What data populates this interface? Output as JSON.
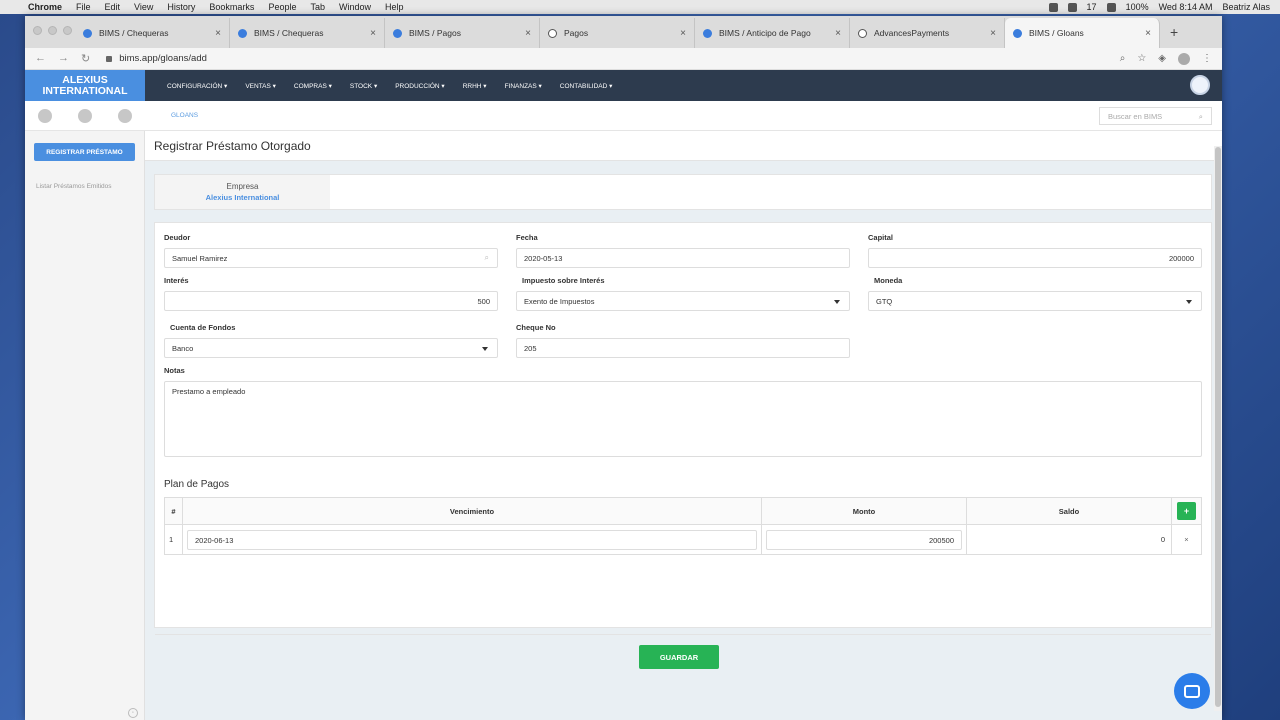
{
  "macbar": {
    "app": "Chrome",
    "menus": [
      "File",
      "Edit",
      "View",
      "History",
      "Bookmarks",
      "People",
      "Tab",
      "Window",
      "Help"
    ],
    "battery": "100%",
    "time": "Wed 8:14 AM",
    "user": "Beatriz Alas",
    "badge": "17"
  },
  "tabs": [
    {
      "title": "BIMS / Chequeras",
      "icon": "bims-icon"
    },
    {
      "title": "BIMS / Chequeras",
      "icon": "bims-icon"
    },
    {
      "title": "BIMS / Pagos",
      "icon": "bims-icon"
    },
    {
      "title": "Pagos",
      "icon": "globe-icon"
    },
    {
      "title": "BIMS / Anticipo de Pago",
      "icon": "bims-icon"
    },
    {
      "title": "AdvancesPayments",
      "icon": "globe-icon"
    },
    {
      "title": "BIMS / Gloans",
      "icon": "bims-icon"
    }
  ],
  "address": "bims.app/gloans/add",
  "brand": {
    "line1": "ALEXIUS",
    "line2": "INTERNATIONAL"
  },
  "mainmenu": [
    "CONFIGURACIÓN ▾",
    "VENTAS ▾",
    "COMPRAS ▾",
    "STOCK ▾",
    "PRODUCCIÓN ▾",
    "RRHH ▾",
    "FINANZAS ▾",
    "CONTABILIDAD ▾"
  ],
  "breadcrumb": "GLOANS",
  "search_placeholder": "Buscar en BIMS",
  "sidebar": {
    "primary_button": "REGISTRAR PRÉSTAMO",
    "link": "Listar Préstamos Emitidos"
  },
  "page_title": "Registrar Préstamo Otorgado",
  "empresa": {
    "label": "Empresa",
    "value": "Alexius International"
  },
  "form": {
    "deudor": {
      "label": "Deudor",
      "value": "Samuel Ramirez"
    },
    "fecha": {
      "label": "Fecha",
      "value": "2020-05-13"
    },
    "capital": {
      "label": "Capital",
      "value": "200000"
    },
    "interes": {
      "label": "Interés",
      "value": "500"
    },
    "impuesto": {
      "label": "Impuesto sobre Interés",
      "value": "Exento de Impuestos"
    },
    "moneda": {
      "label": "Moneda",
      "value": "GTQ"
    },
    "cuenta": {
      "label": "Cuenta de Fondos",
      "value": "Banco"
    },
    "cheque": {
      "label": "Cheque No",
      "value": "205"
    },
    "notas": {
      "label": "Notas",
      "value": "Prestamo a empleado"
    }
  },
  "plan": {
    "title": "Plan de Pagos",
    "headers": [
      "#",
      "Vencimiento",
      "Monto",
      "Saldo"
    ],
    "add_label": "+",
    "rows": [
      {
        "n": "1",
        "vencimiento": "2020-06-13",
        "monto": "200500",
        "saldo": "0",
        "remove": "×"
      }
    ]
  },
  "save_label": "GUARDAR"
}
